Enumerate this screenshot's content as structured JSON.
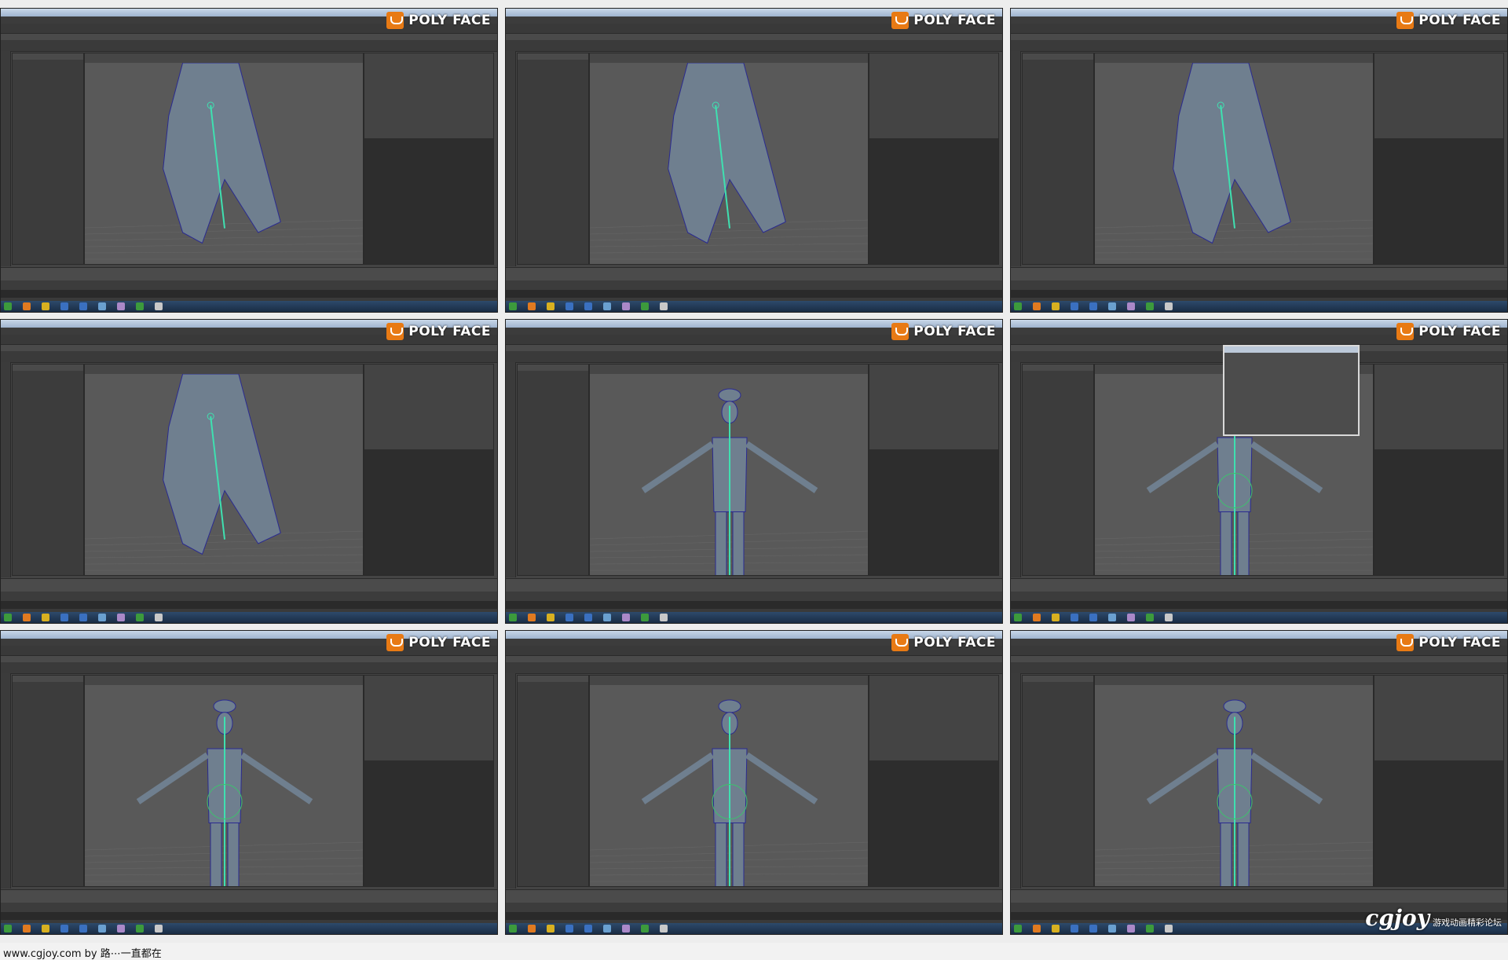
{
  "panels": [
    {
      "logo": "POLY FACE",
      "scene": "hand-closeup"
    },
    {
      "logo": "POLY FACE",
      "scene": "arm-hand"
    },
    {
      "logo": "POLY FACE",
      "scene": "hand-fingers"
    },
    {
      "logo": "POLY FACE",
      "scene": "hand-wide"
    },
    {
      "logo": "POLY FACE",
      "scene": "full-body"
    },
    {
      "logo": "POLY FACE",
      "scene": "full-body-dialog"
    },
    {
      "logo": "POLY FACE",
      "scene": "torso-arms"
    },
    {
      "logo": "POLY FACE",
      "scene": "front-body"
    },
    {
      "logo": "POLY FACE",
      "scene": "side-body"
    }
  ],
  "footer": {
    "text": "www.cgjoy.com by 路⋯一直都在"
  },
  "watermark": {
    "text": "cgjoy",
    "subtext": "游戏动画精彩论坛"
  },
  "colors": {
    "accent": "#e87a14",
    "joint": "#3fe0b0",
    "wire": "#2a2a90"
  }
}
